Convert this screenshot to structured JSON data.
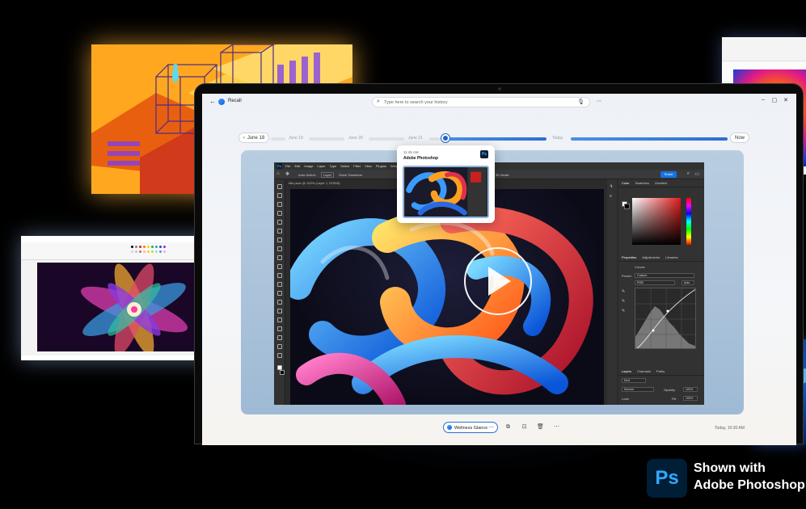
{
  "recall": {
    "title": "Recall",
    "search_placeholder": "Type here to search your history",
    "timeline": {
      "back_label": "June 18",
      "labels": [
        "June 19",
        "June 20",
        "June 21",
        "Today"
      ],
      "now_label": "Now"
    },
    "hover_card": {
      "time": "11:45 AM",
      "app": "Adobe Photoshop"
    },
    "bottom": {
      "chip_label": "Wellness Glance",
      "timestamp": "Today, 10:30 AM"
    }
  },
  "photoshop": {
    "menu": [
      "File",
      "Edit",
      "Image",
      "Layer",
      "Type",
      "Select",
      "Filter",
      "View",
      "Plugins",
      "Window",
      "Help"
    ],
    "options": {
      "auto_select": "Auto-Select:",
      "layer": "Layer",
      "show_transform": "Show Transform",
      "mode_3d": "3D Mode:"
    },
    "share_label": "Share",
    "doc_tab": "title.psdc @ 100% (Layer 1, RGB/8)",
    "panels": {
      "color_tabs": [
        "Color",
        "Swatches",
        "Gradient"
      ],
      "prop_tabs": [
        "Properties",
        "Adjustments",
        "Libraries"
      ],
      "curves_label": "Curves",
      "preset_label": "Preset:",
      "preset_value": "Custom",
      "channel_value": "RGB",
      "auto_label": "Auto",
      "layer_tabs": [
        "Layers",
        "Channels",
        "Paths"
      ],
      "kind_label": "Kind",
      "blend_mode": "Normal",
      "opacity_label": "Opacity:",
      "opacity_value": "100%",
      "lock_label": "Lock:",
      "fill_label": "Fill:",
      "fill_value": "100%"
    }
  },
  "badge": {
    "logo_text": "Ps",
    "line1": "Shown with",
    "line2": "Adobe Photoshop"
  },
  "colors": {
    "accent": "#2566c9",
    "ps_blue": "#31a8ff",
    "ps_navy": "#001e36",
    "share_blue": "#1473e6"
  }
}
